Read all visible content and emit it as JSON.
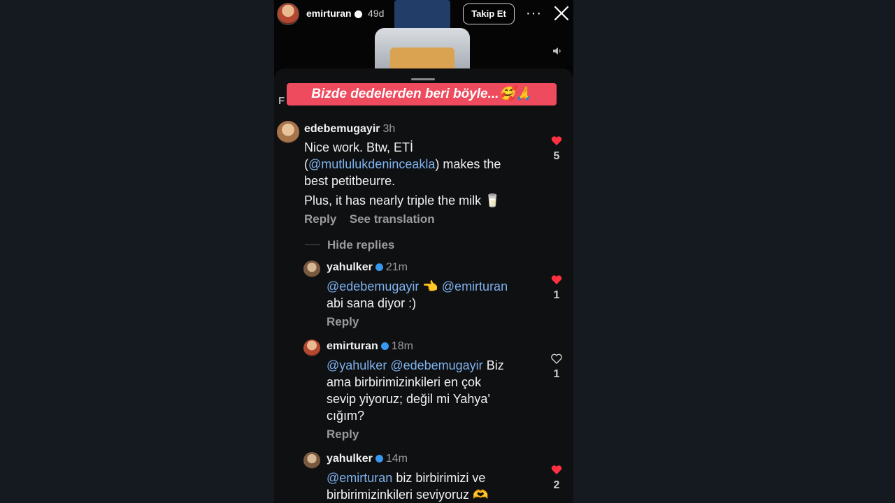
{
  "story": {
    "username": "emirturan",
    "time": "49d",
    "follow_label": "Takip Et",
    "more_label": "···"
  },
  "banner_text": "Bizde dedelerden beri böyle...🥰🙏",
  "sheet_partial_label": "F",
  "comments": [
    {
      "username": "edebemugayir",
      "time": "3h",
      "lines": [
        [
          "Nice work. Btw, ETİ"
        ],
        [
          "(",
          "@mutlulukdeninceakla",
          ") makes the"
        ],
        [
          "best petitbeurre."
        ]
      ],
      "extra_line": "Plus, it has nearly triple the milk 🥛",
      "reply_label": "Reply",
      "translate_label": "See translation",
      "likes": "5",
      "liked": true
    }
  ],
  "hide_replies_label": "Hide replies",
  "replies": [
    {
      "username": "yahulker",
      "time": "21m",
      "line1_mention1": "@edebemugayir",
      "line1_emoji": " 👈 ",
      "line1_mention2": "@emirturan",
      "line2": "abi sana diyor :)",
      "reply_label": "Reply",
      "likes": "1",
      "liked": true
    },
    {
      "username": "emirturan",
      "time": "18m",
      "line1_mention1": "@yahulker",
      "line1_mention2": "@edebemugayir",
      "line1_text": " Biz",
      "line2": "ama birbirimizinkileri en çok",
      "line3": "sevip yiyoruz; değil mi Yahya'",
      "line4": "cığım?",
      "reply_label": "Reply",
      "likes": "1",
      "liked": false
    },
    {
      "username": "yahulker",
      "time": "14m",
      "line1_mention": "@emirturan",
      "line1_text": " biz birbirimizi ve",
      "line2": "birbirimizinkileri seviyoruz 🫶",
      "likes": "2",
      "liked": true
    }
  ],
  "colors": {
    "accent_blue": "#3897f0",
    "mention": "#7fb2ee",
    "like_red": "#ff3040",
    "banner": "#ef4b5e"
  }
}
